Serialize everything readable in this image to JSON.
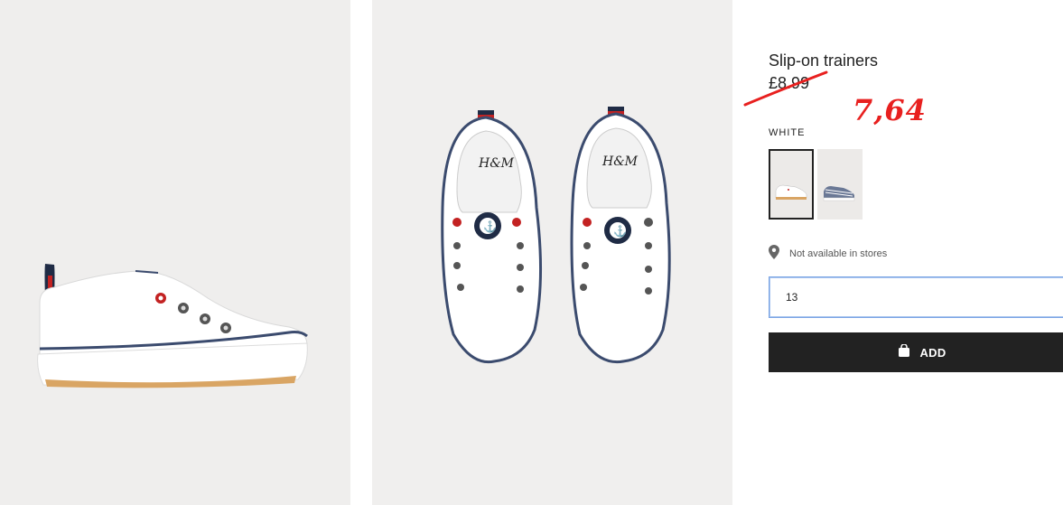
{
  "product": {
    "title": "Slip-on trainers",
    "original_price": "£8.99",
    "new_price_annotation": "7,64",
    "color_label": "WHITE"
  },
  "swatches": [
    {
      "name": "white",
      "selected": true
    },
    {
      "name": "blue-striped",
      "selected": false
    }
  ],
  "availability": {
    "icon": "location-pin-icon",
    "text": "Not available in stores"
  },
  "size_select": {
    "value": "13"
  },
  "add_button": {
    "icon": "shopping-bag-icon",
    "label": "ADD"
  },
  "colors": {
    "button_bg": "#222222",
    "annotation_red": "#e8201f",
    "focus_border": "#7aa4e4",
    "photo_bg": "#efeeed"
  }
}
